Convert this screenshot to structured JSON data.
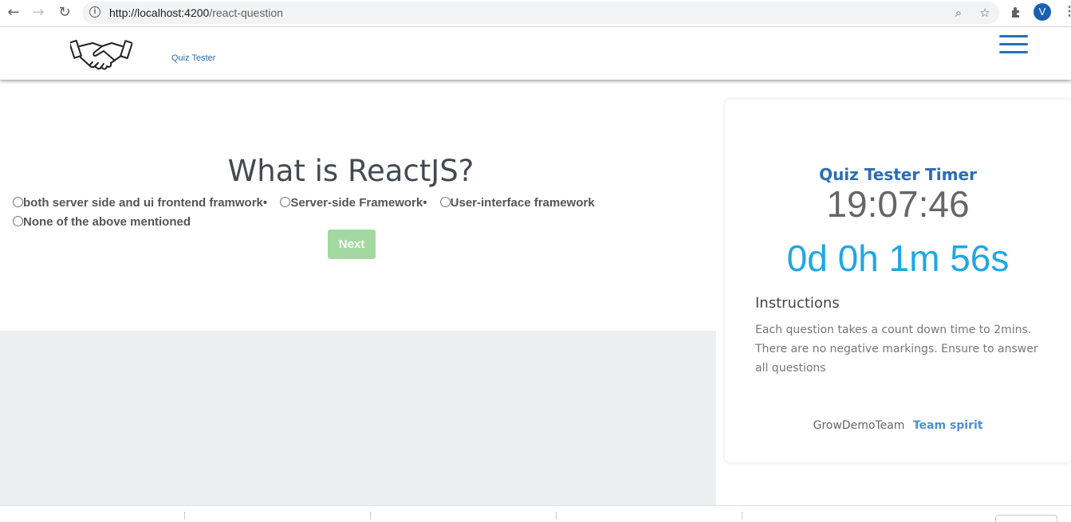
{
  "browser": {
    "url_host": "http://localhost:4200",
    "url_path": "/react-question",
    "profile_initial": "V",
    "icons": [
      "back-arrow-icon",
      "forward-arrow-icon",
      "reload-icon",
      "info-icon",
      "zoom-icon",
      "star-icon",
      "extensions-icon",
      "menu-dots-icon"
    ]
  },
  "header": {
    "brand_link": "Quiz Tester",
    "logo_icon": "handshake-icon",
    "menu_icon": "hamburger-icon"
  },
  "question": {
    "title": "What is ReactJS?",
    "options": [
      "both server side and ui frontend framwork•",
      "Server-side Framework•",
      "User-interface framework",
      "None of the above mentioned"
    ],
    "next_label": "Next"
  },
  "timer": {
    "title": "Quiz Tester Timer",
    "clock": "19:07:46",
    "countdown": "0d 0h 1m 56s",
    "instructions_heading": "Instructions",
    "instructions_text": "Each question takes a count down time to 2mins. There are no negative markings. Ensure to answer all questions",
    "footer_team": "GrowDemoTeam",
    "footer_link": "Team spirit"
  },
  "colors": {
    "brand_blue": "#2a6db5",
    "countdown_blue": "#1ea7e6",
    "next_button_green": "#a3d9a1",
    "grey_area": "#eceef0"
  }
}
